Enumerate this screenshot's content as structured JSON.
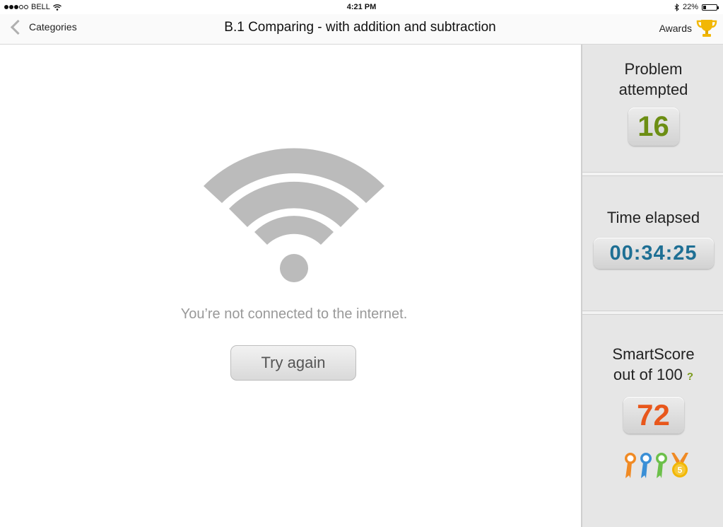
{
  "status_bar": {
    "carrier": "BELL",
    "time": "4:21 PM",
    "battery_percent": "22%",
    "battery_level": 0.22,
    "signal_bars_filled": 3,
    "signal_bars_total": 5
  },
  "nav": {
    "back_label": "Categories",
    "title": "B.1 Comparing - with addition and subtraction",
    "awards_label": "Awards"
  },
  "main": {
    "message": "You’re not connected to the internet.",
    "try_again_label": "Try again"
  },
  "sidebar": {
    "problems": {
      "label_line1": "Problem",
      "label_line2": "attempted",
      "value": "16",
      "color": "#6c8e13"
    },
    "time": {
      "label": "Time elapsed",
      "value": "00:34:25",
      "color": "#1e6f94"
    },
    "smartscore": {
      "label_line1": "SmartScore",
      "label_line2": "out of 100",
      "help": "?",
      "value": "72",
      "color": "#e8571c"
    },
    "medal_number": "5"
  },
  "colors": {
    "wifi_gray": "#bbbbbb",
    "trophy_gold": "#f2b705",
    "ribbon_orange": "#f08a24",
    "ribbon_blue": "#3a8fd6",
    "ribbon_green": "#6cc04a"
  }
}
